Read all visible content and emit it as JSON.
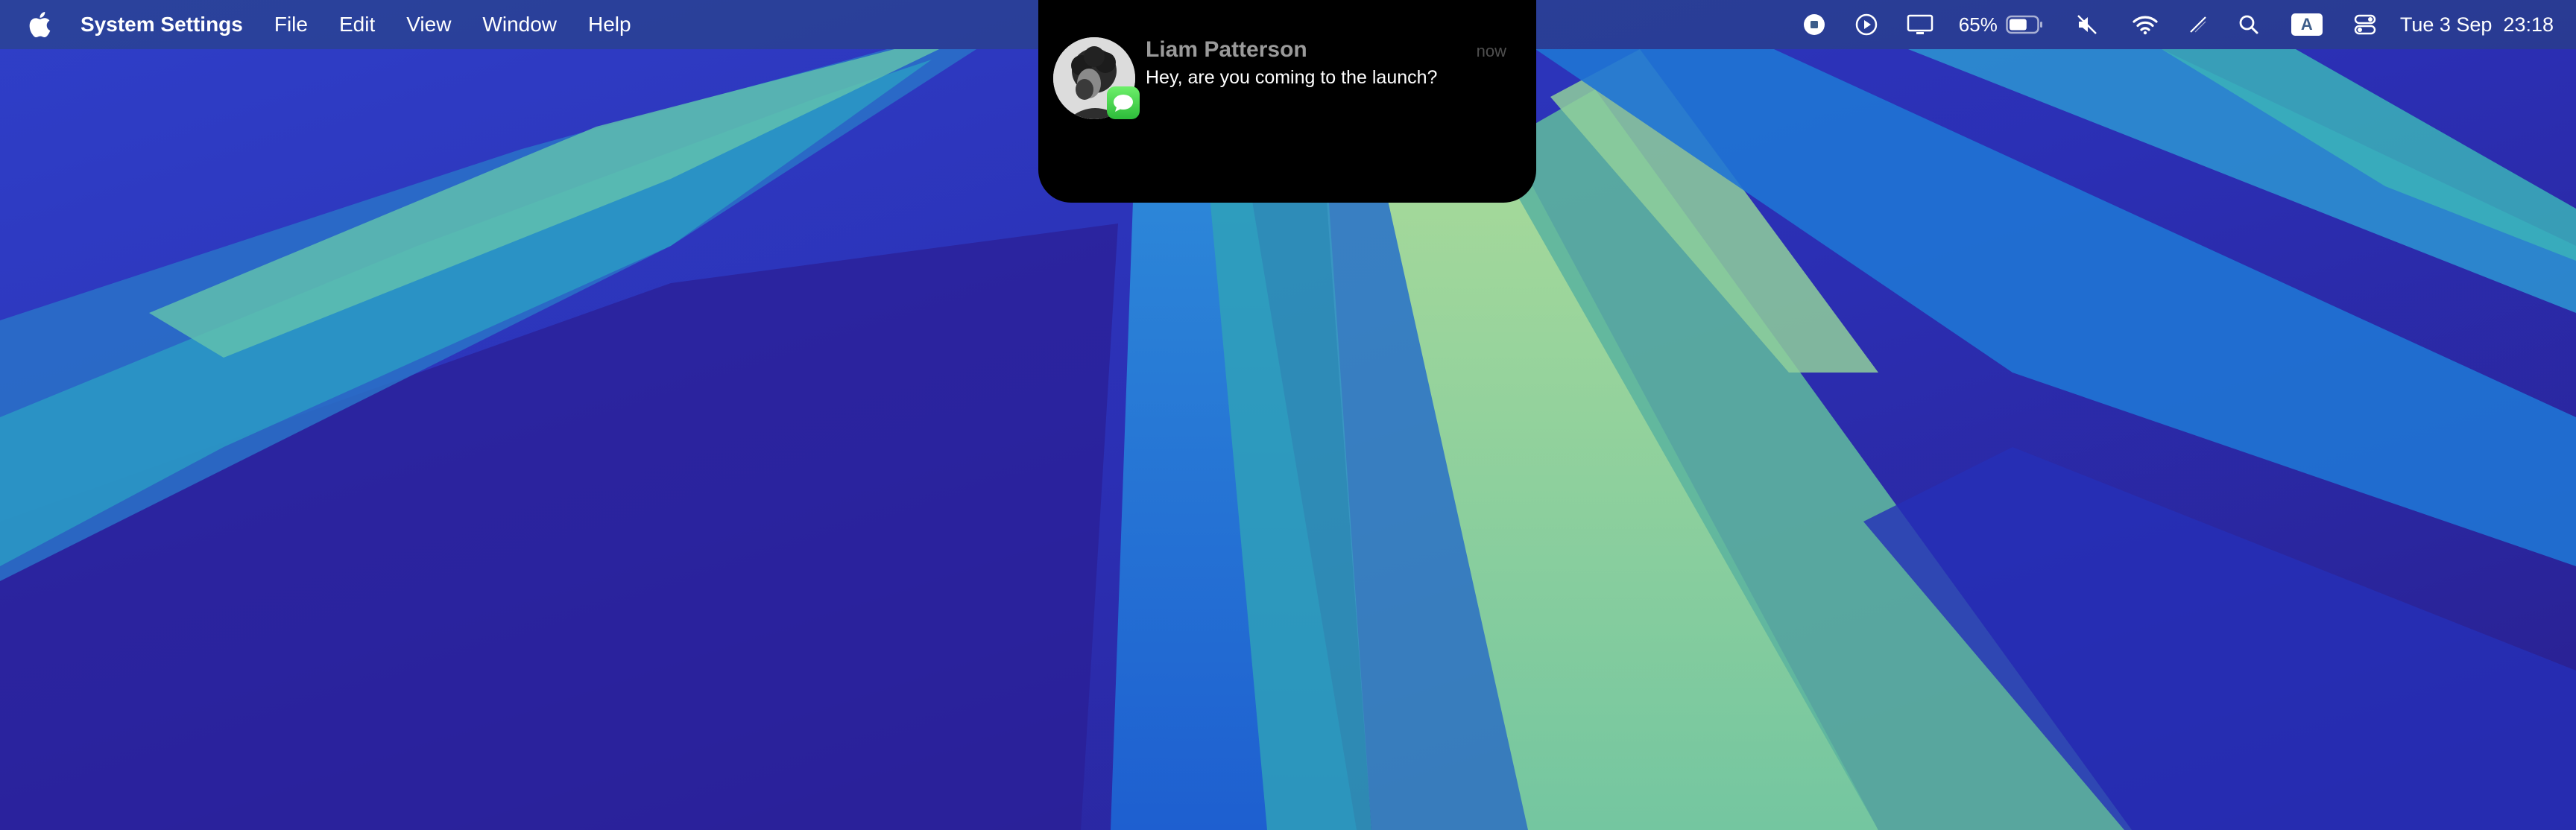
{
  "menubar": {
    "apple_icon": "apple-logo-icon",
    "app_name": "System Settings",
    "menus": [
      "File",
      "Edit",
      "View",
      "Window",
      "Help"
    ],
    "status": {
      "screen_record_icon": "stop-recording-icon",
      "play_icon": "play-circle-icon",
      "display_icon": "display-icon",
      "battery_percent": "65%",
      "battery_level": 0.65,
      "mute_icon": "speaker-muted-icon",
      "wifi_icon": "wifi-icon",
      "slash_icon": "pencil-slash-icon",
      "search_icon": "spotlight-search-icon",
      "input_source": "A",
      "control_center_icon": "control-center-icon",
      "datetime": "Tue 3 Sep  23:18"
    }
  },
  "notification": {
    "sender": "Liam Patterson",
    "time": "now",
    "message": "Hey, are you coming to the launch?",
    "app_badge_icon": "messages-app-icon",
    "avatar_icon": "contact-avatar"
  },
  "colors": {
    "menubar_bg": "#3d5d8a",
    "notification_bg": "#000000",
    "messages_green": "#34c759",
    "wallpaper_blue": "#2d2fb0",
    "wallpaper_green": "#9cd19a"
  }
}
